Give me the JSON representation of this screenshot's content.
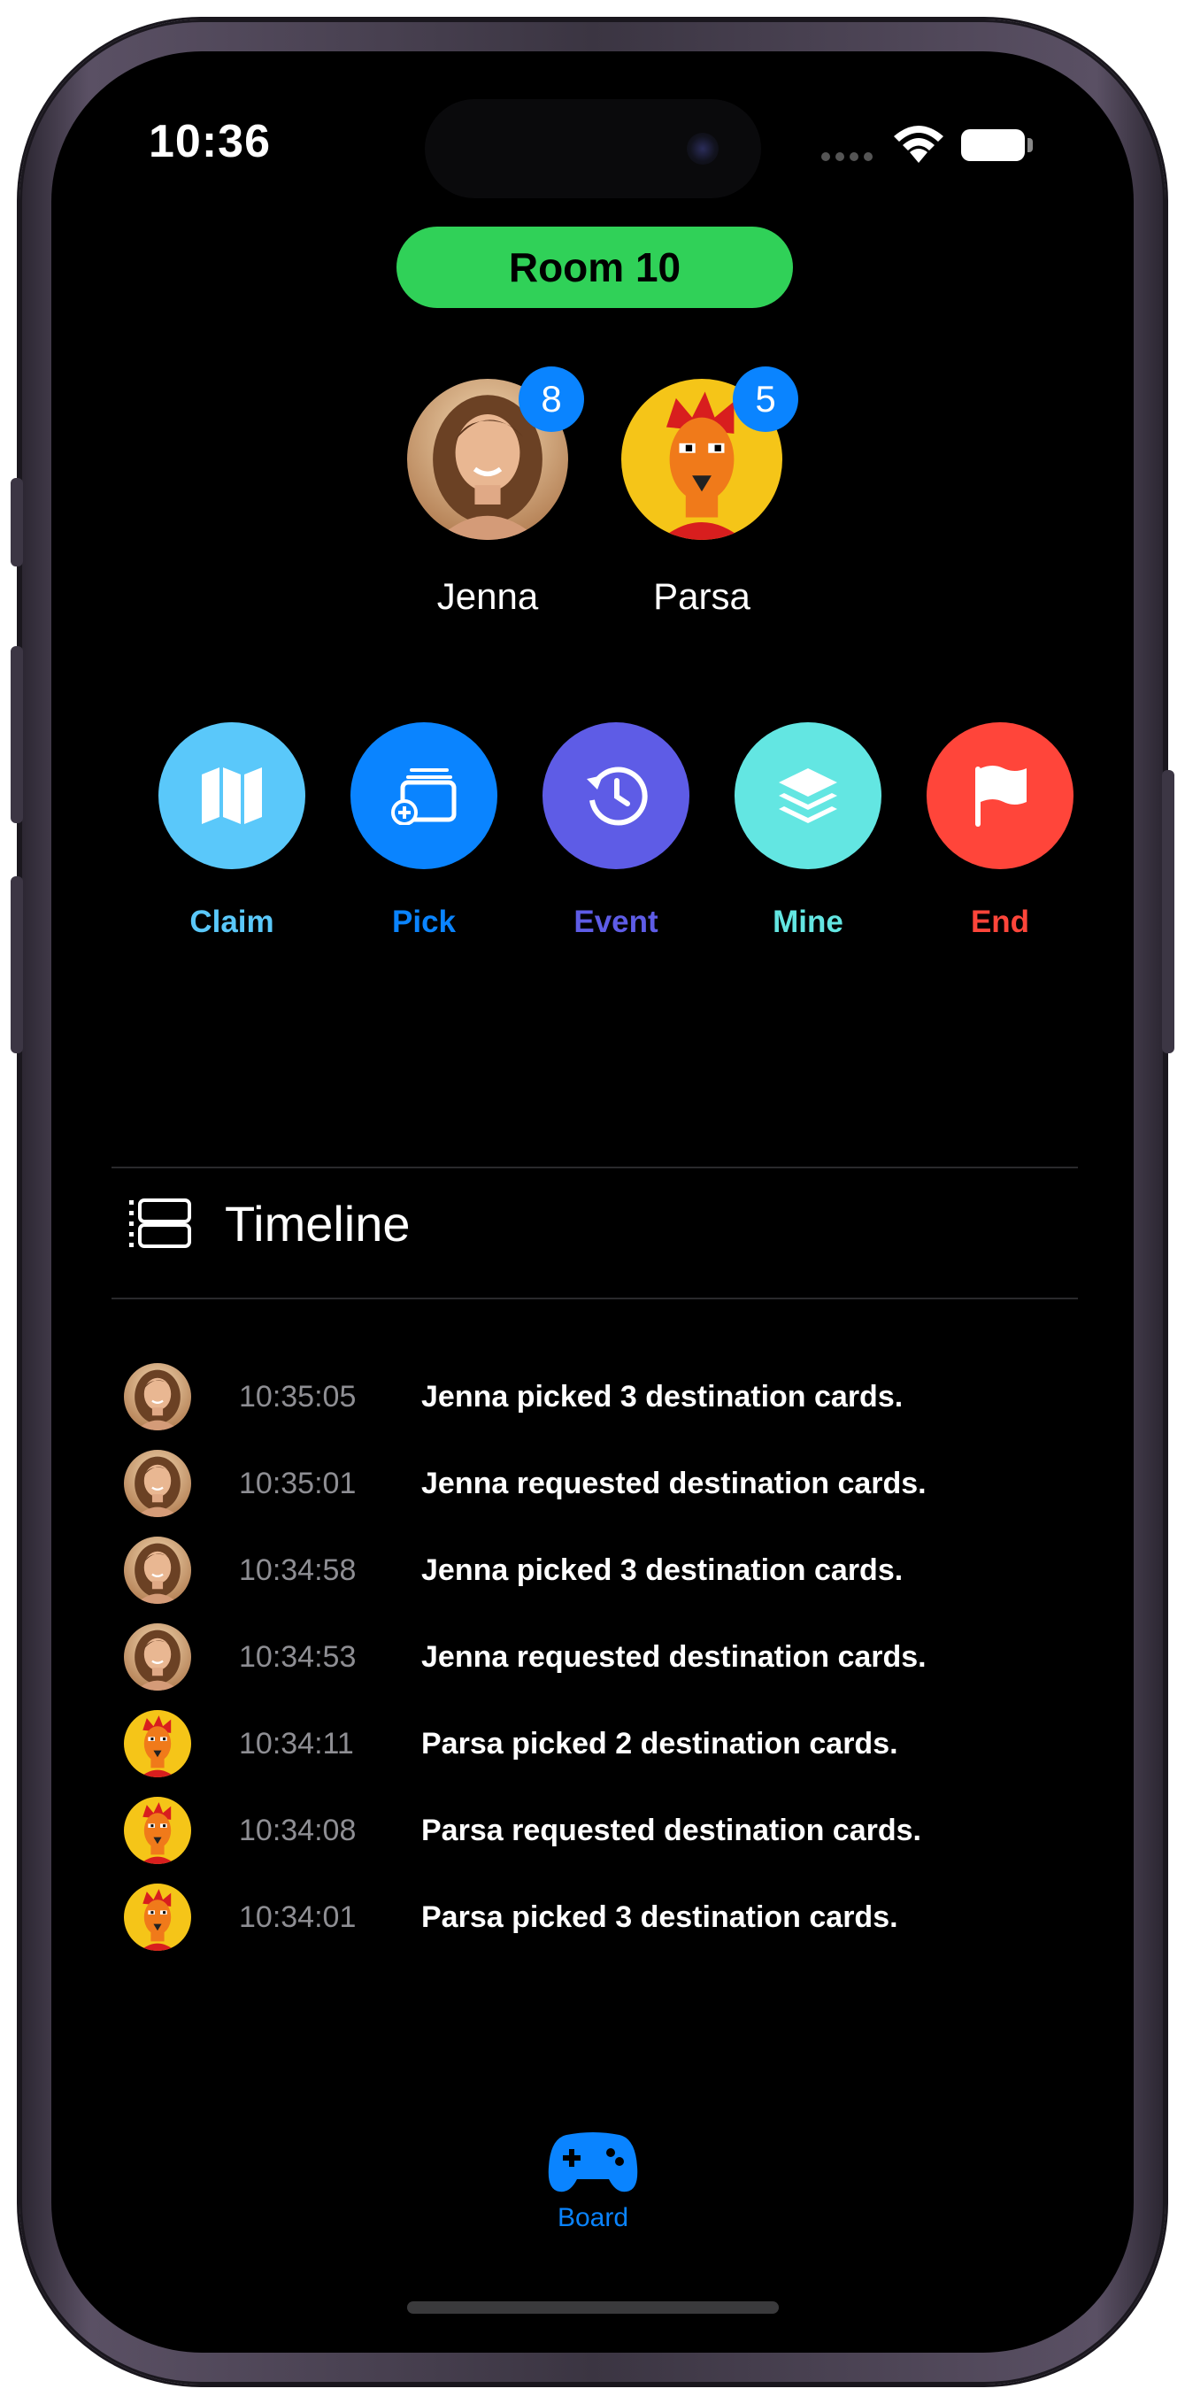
{
  "status_bar": {
    "time": "10:36"
  },
  "room": {
    "label": "Room 10",
    "color": "#30d158"
  },
  "players": [
    {
      "name": "Jenna",
      "count": "8",
      "avatar": "jenna-photo"
    },
    {
      "name": "Parsa",
      "count": "5",
      "avatar": "parsa-illustration"
    }
  ],
  "actions": [
    {
      "label": "Claim",
      "icon": "map-icon",
      "color": "#5ac8fa"
    },
    {
      "label": "Pick",
      "icon": "cards-add-icon",
      "color": "#0a84ff"
    },
    {
      "label": "Event",
      "icon": "history-icon",
      "color": "#5e5ce6"
    },
    {
      "label": "Mine",
      "icon": "layers-icon",
      "color": "#63e6e2"
    },
    {
      "label": "End",
      "icon": "flag-icon",
      "color": "#ff453a"
    }
  ],
  "timeline": {
    "title": "Timeline",
    "entries": [
      {
        "player": "Jenna",
        "time": "10:35:05",
        "text": "Jenna picked 3 destination cards."
      },
      {
        "player": "Jenna",
        "time": "10:35:01",
        "text": "Jenna requested destination cards."
      },
      {
        "player": "Jenna",
        "time": "10:34:58",
        "text": "Jenna picked 3 destination cards."
      },
      {
        "player": "Jenna",
        "time": "10:34:53",
        "text": "Jenna requested destination cards."
      },
      {
        "player": "Parsa",
        "time": "10:34:11",
        "text": "Parsa picked 2 destination cards."
      },
      {
        "player": "Parsa",
        "time": "10:34:08",
        "text": "Parsa requested destination cards."
      },
      {
        "player": "Parsa",
        "time": "10:34:01",
        "text": "Parsa picked 3 destination cards."
      }
    ]
  },
  "tab_bar": {
    "items": [
      {
        "label": "Board",
        "icon": "gamecontroller-icon",
        "color": "#0a84ff"
      }
    ]
  }
}
